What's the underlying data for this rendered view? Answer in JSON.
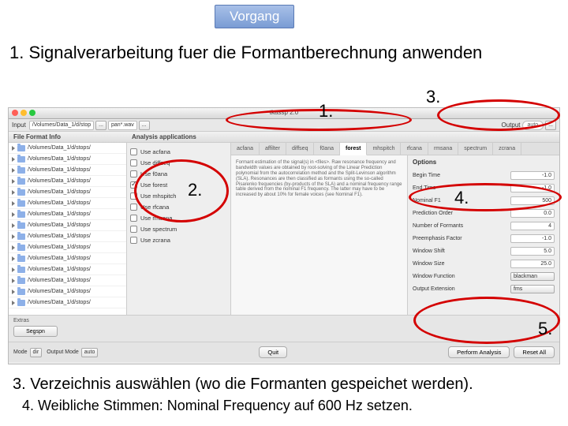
{
  "header": {
    "button": "Vorgang",
    "title": "1. Signalverarbeitung fuer die Formantberechnung anwenden",
    "step3": "3. Verzeichnis auswählen (wo die Formanten gespeichet werden).",
    "step4": "4. Weibliche Stimmen: Nominal Frequency auf 600 Hz setzen."
  },
  "annotations": {
    "a1": "1.",
    "a2": "2.",
    "a3": "3.",
    "a4": "4.",
    "a5": "5."
  },
  "window": {
    "title": "tkassp 2.0",
    "input_label": "Input",
    "path_root": "/Volumes/Data_1/d/stop",
    "path_wild": "pan*.wav",
    "dots": "...",
    "output_label": "Output",
    "output_value": "auto",
    "sections": {
      "files": "File Format Info",
      "apps": "Analysis applications"
    },
    "files": [
      "/Volumes/Data_1/d/stops/",
      "/Volumes/Data_1/d/stops/",
      "/Volumes/Data_1/d/stops/",
      "/Volumes/Data_1/d/stops/",
      "/Volumes/Data_1/d/stops/",
      "/Volumes/Data_1/d/stops/",
      "/Volumes/Data_1/d/stops/",
      "/Volumes/Data_1/d/stops/",
      "/Volumes/Data_1/d/stops/",
      "/Volumes/Data_1/d/stops/",
      "/Volumes/Data_1/d/stops/",
      "/Volumes/Data_1/d/stops/",
      "/Volumes/Data_1/d/stops/",
      "/Volumes/Data_1/d/stops/",
      "/Volumes/Data_1/d/stops/"
    ],
    "apps": [
      {
        "label": "Use acfana",
        "checked": false
      },
      {
        "label": "Use diffseq",
        "checked": false
      },
      {
        "label": "Use f0ana",
        "checked": false
      },
      {
        "label": "Use forest",
        "checked": true
      },
      {
        "label": "Use mhspitch",
        "checked": false
      },
      {
        "label": "Use rfcana",
        "checked": false
      },
      {
        "label": "Use rmsana",
        "checked": false
      },
      {
        "label": "Use spectrum",
        "checked": false
      },
      {
        "label": "Use zcrana",
        "checked": false
      }
    ],
    "tabs": [
      "acfana",
      "affilter",
      "diffseq",
      "f0ana",
      "forest",
      "mhspitch",
      "rfcana",
      "rmsana",
      "spectrum",
      "zcrana"
    ],
    "active_tab": 4,
    "description": "Formant estimation of the signal(s) in <files>. Raw resonance frequency and bandwidth values are obtained by root-solving of the Linear Prediction polynomial from the autocorrelation method and the Split-Levinson algorithm (SLA). Resonances are then classified as formants using the so-called Pisarenko frequencies (by-products of the SLA) and a nominal frequency range table derived from the nominal F1 frequency. The latter may have to be increased by about 10% for female voices (see Nominal F1).",
    "options_title": "Options",
    "options": [
      {
        "label": "Begin Time",
        "value": "-1.0",
        "type": "val"
      },
      {
        "label": "End Time",
        "value": "-1.0",
        "type": "val"
      },
      {
        "label": "Nominal F1",
        "value": "500",
        "type": "val"
      },
      {
        "label": "Prediction Order",
        "value": "0.0",
        "type": "val"
      },
      {
        "label": "Number of Formants",
        "value": "4",
        "type": "val"
      },
      {
        "label": "Preemphasis Factor",
        "value": "-1.0",
        "type": "val"
      },
      {
        "label": "Window Shift",
        "value": "5.0",
        "type": "val"
      },
      {
        "label": "Window Size",
        "value": "25.0",
        "type": "val"
      },
      {
        "label": "Window Function",
        "value": "blackman",
        "type": "dd"
      },
      {
        "label": "Output Extension",
        "value": "fms",
        "type": "dd"
      }
    ],
    "extras_title": "Extras",
    "extras_btn": "Segspn",
    "bottom": {
      "mode_label": "Mode",
      "mode_value": "dir",
      "outmode_label": "Output Mode",
      "outmode_value": "auto",
      "quit": "Quit",
      "perform": "Perform Analysis",
      "reset": "Reset All"
    }
  }
}
